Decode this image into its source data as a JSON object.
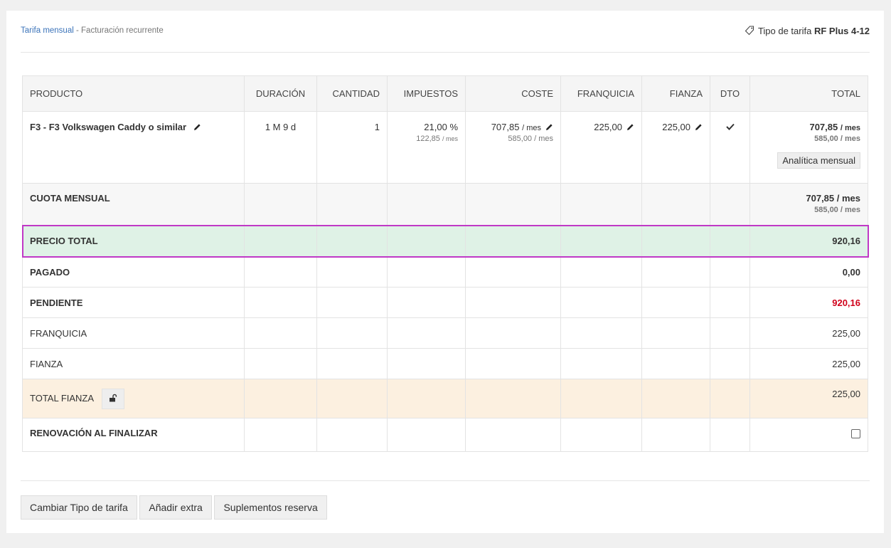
{
  "header": {
    "breadcrumb_link": "Tarifa mensual",
    "breadcrumb_sep": " - ",
    "breadcrumb_rest": "Facturación recurrente",
    "tarifa_label": "Tipo de tarifa",
    "tarifa_value": "RF Plus 4-12"
  },
  "table": {
    "headers": [
      "PRODUCTO",
      "DURACIÓN",
      "CANTIDAD",
      "IMPUESTOS",
      "COSTE",
      "FRANQUICIA",
      "FIANZA",
      "DTO",
      "TOTAL"
    ],
    "product": {
      "name": "F3 - F3 Volkswagen Caddy o similar",
      "duracion": "1 M 9 d",
      "cantidad": "1",
      "impuestos": "21,00 %",
      "impuestos_sub": "122,85",
      "impuestos_sub_unit": "/ mes",
      "coste": "707,85",
      "coste_unit": "/ mes",
      "coste_sub": "585,00 / mes",
      "franquicia": "225,00",
      "fianza": "225,00",
      "total": "707,85",
      "total_unit": "/ mes",
      "total_sub": "585,00 / mes",
      "analitica_label": "Analítica mensual"
    },
    "cuota": {
      "label": "CUOTA MENSUAL",
      "total": "707,85 / mes",
      "total_sub": "585,00 / mes"
    },
    "precio_total": {
      "label": "PRECIO TOTAL",
      "value": "920,16"
    },
    "pagado": {
      "label": "PAGADO",
      "value": "0,00"
    },
    "pendiente": {
      "label": "PENDIENTE",
      "value": "920,16"
    },
    "franquicia": {
      "label": "FRANQUICIA",
      "value": "225,00"
    },
    "fianza": {
      "label": "FIANZA",
      "value": "225,00"
    },
    "total_fianza": {
      "label": "TOTAL FIANZA",
      "value": "225,00"
    },
    "renovacion": {
      "label": "RENOVACIÓN AL FINALIZAR"
    }
  },
  "actions": {
    "cambiar": "Cambiar Tipo de tarifa",
    "extra": "Añadir extra",
    "suplementos": "Suplementos reserva"
  },
  "colors": {
    "link": "#3b73b9",
    "pending": "#d0021b",
    "precio_bg": "#dff2e6",
    "fianza_bg": "#fcf0e0",
    "highlight": "#c039c6"
  }
}
